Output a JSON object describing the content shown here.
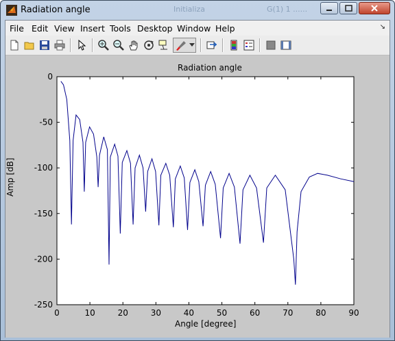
{
  "window": {
    "title": "Radiation angle",
    "background_titles": [
      "Initializa",
      "G(1) 1 ......"
    ]
  },
  "menu": {
    "items": [
      "File",
      "Edit",
      "View",
      "Insert",
      "Tools",
      "Desktop",
      "Window",
      "Help"
    ]
  },
  "toolbar": {
    "buttons": [
      "new-figure",
      "open-file",
      "save-figure",
      "print-figure",
      "edit-plot",
      "zoom-in",
      "zoom-out",
      "pan",
      "rotate-3d",
      "data-cursor",
      "brush",
      "link-plot",
      "insert-colorbar",
      "insert-legend",
      "hide-plot-tools",
      "show-plot-tools"
    ]
  },
  "colors": {
    "line": "#00008b",
    "axes_bg": "#ffffff",
    "figure_bg": "#c8c8c8"
  },
  "chart_data": {
    "type": "line",
    "title": "Radiation angle",
    "xlabel": "Angle [degree]",
    "ylabel": "Amp [dB]",
    "xlim": [
      0,
      90
    ],
    "ylim": [
      -250,
      0
    ],
    "xticks": [
      "0",
      "10",
      "20",
      "30",
      "40",
      "50",
      "60",
      "70",
      "80",
      "90"
    ],
    "yticks": [
      "0",
      "-50",
      "-100",
      "-150",
      "-200",
      "-250"
    ],
    "grid": false,
    "series": [
      {
        "points": [
          [
            1.2,
            -5
          ],
          [
            2.0,
            -9
          ],
          [
            3.0,
            -25
          ],
          [
            3.9,
            -70
          ],
          [
            4.4,
            -162
          ],
          [
            4.9,
            -70
          ],
          [
            5.8,
            -42
          ],
          [
            6.9,
            -47
          ],
          [
            7.9,
            -72
          ],
          [
            8.3,
            -126
          ],
          [
            8.7,
            -72
          ],
          [
            9.9,
            -55
          ],
          [
            11.1,
            -63
          ],
          [
            12.1,
            -88
          ],
          [
            12.5,
            -121
          ],
          [
            12.9,
            -86
          ],
          [
            14.2,
            -66
          ],
          [
            15.3,
            -80
          ],
          [
            15.8,
            -206
          ],
          [
            16.2,
            -88
          ],
          [
            17.5,
            -74
          ],
          [
            18.5,
            -87
          ],
          [
            19.2,
            -172
          ],
          [
            19.8,
            -94
          ],
          [
            21.2,
            -81
          ],
          [
            22.3,
            -95
          ],
          [
            23.1,
            -162
          ],
          [
            23.7,
            -100
          ],
          [
            25.0,
            -86
          ],
          [
            26.1,
            -100
          ],
          [
            26.9,
            -148
          ],
          [
            27.5,
            -104
          ],
          [
            28.8,
            -90
          ],
          [
            29.9,
            -104
          ],
          [
            30.9,
            -163
          ],
          [
            31.5,
            -108
          ],
          [
            33.0,
            -95
          ],
          [
            34.2,
            -108
          ],
          [
            35.3,
            -165
          ],
          [
            35.9,
            -112
          ],
          [
            37.4,
            -98
          ],
          [
            38.6,
            -111
          ],
          [
            39.6,
            -168
          ],
          [
            40.3,
            -116
          ],
          [
            41.8,
            -102
          ],
          [
            43.0,
            -115
          ],
          [
            44.3,
            -164
          ],
          [
            45.0,
            -119
          ],
          [
            46.6,
            -104
          ],
          [
            48.0,
            -118
          ],
          [
            49.6,
            -177
          ],
          [
            50.4,
            -122
          ],
          [
            52.2,
            -106
          ],
          [
            53.8,
            -121
          ],
          [
            55.5,
            -183
          ],
          [
            56.4,
            -124
          ],
          [
            58.5,
            -108
          ],
          [
            60.5,
            -122
          ],
          [
            62.6,
            -182
          ],
          [
            63.6,
            -122
          ],
          [
            66.2,
            -108
          ],
          [
            69.2,
            -124
          ],
          [
            71.8,
            -200
          ],
          [
            72.3,
            -228
          ],
          [
            72.8,
            -170
          ],
          [
            74.0,
            -126
          ],
          [
            76.5,
            -110
          ],
          [
            79.0,
            -106
          ],
          [
            82.0,
            -108
          ],
          [
            86.0,
            -112
          ],
          [
            90.0,
            -115
          ]
        ]
      }
    ]
  }
}
